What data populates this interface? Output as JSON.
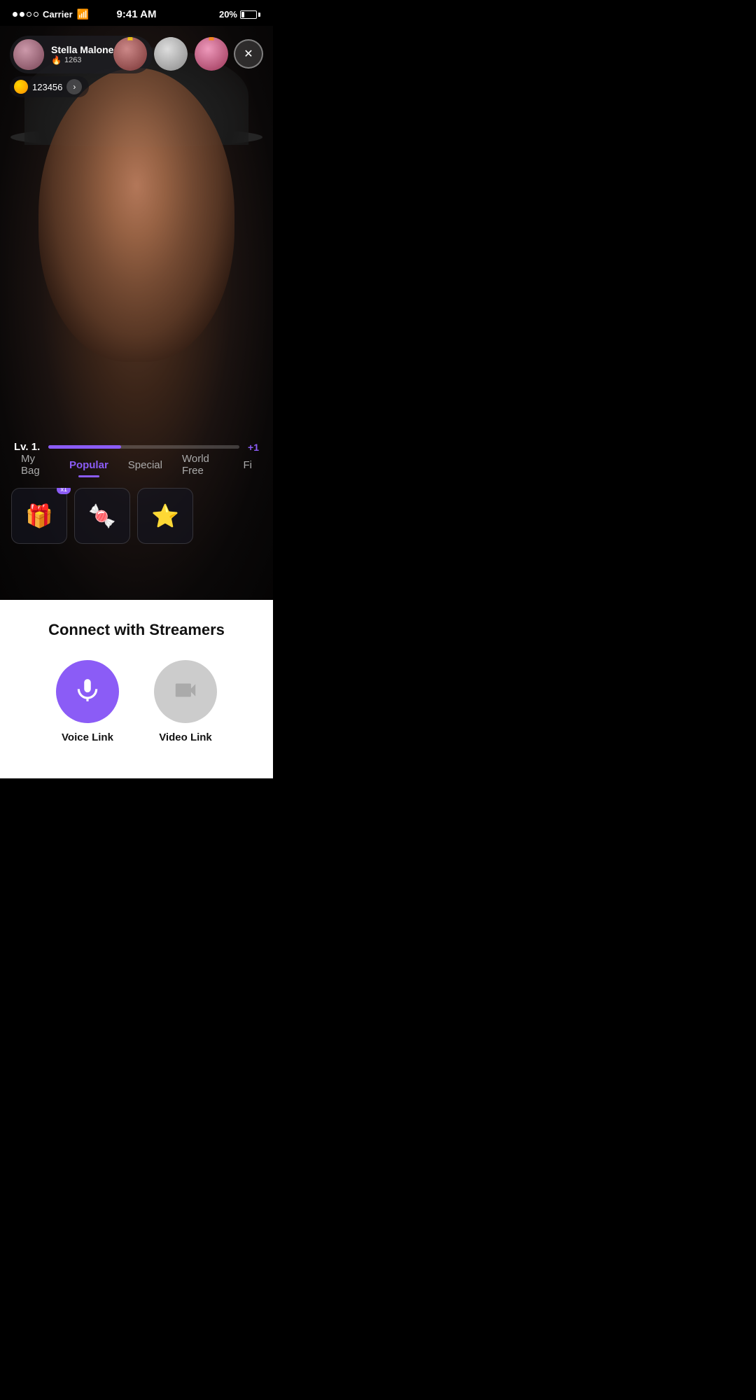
{
  "statusBar": {
    "carrier": "Carrier",
    "time": "9:41 AM",
    "battery": "20%"
  },
  "streamer": {
    "name": "Stella Malone",
    "score": "1263",
    "coins": "123456"
  },
  "topViewers": [
    {
      "rank": 1,
      "crownType": "gold",
      "crownChar": "♛"
    },
    {
      "rank": 2,
      "crownType": "silver",
      "crownChar": "♛"
    },
    {
      "rank": 3,
      "crownType": "gold",
      "crownChar": "♛"
    }
  ],
  "levelBar": {
    "label": "Lv. 1.",
    "fillPercent": 38,
    "plus": "+1"
  },
  "tabs": [
    {
      "id": "my-bag",
      "label": "My Bag",
      "active": false
    },
    {
      "id": "popular",
      "label": "Popular",
      "active": true
    },
    {
      "id": "special",
      "label": "Special",
      "active": false
    },
    {
      "id": "world-free",
      "label": "World Free",
      "active": false
    },
    {
      "id": "fi",
      "label": "Fi",
      "active": false
    }
  ],
  "giftItems": [
    {
      "emoji": "🎁",
      "badge": "x1"
    },
    {
      "emoji": "🍬"
    },
    {
      "emoji": "🌟"
    }
  ],
  "connectSection": {
    "title": "Connect with Streamers",
    "voiceLabel": "Voice Link",
    "videoLabel": "Video Link"
  }
}
